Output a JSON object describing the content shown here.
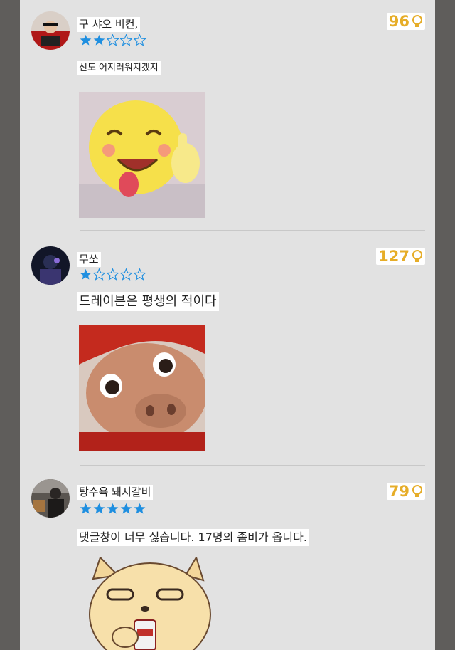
{
  "comments": [
    {
      "username": "구 샤오 비컨,",
      "rating": 2,
      "likes": "96",
      "text": "신도 어지러워지겠지",
      "sticker": "laughing-emoji-thumbs-up"
    },
    {
      "username": "무쏘",
      "rating": 1,
      "likes": "127",
      "text": "드레이븐은 평생의 적이다",
      "sticker": "cartoon-pig-face"
    },
    {
      "username": "탕수육 돼지갈비",
      "rating": 5,
      "likes": "79",
      "text": "댓글창이 너무 싫습니다. 17명의 좀비가 옵니다.",
      "sticker": "cat-drinking-bottle"
    }
  ],
  "colors": {
    "star_filled": "#1f8fe0",
    "star_empty": "#1f8fe0",
    "likes": "#e6ad28",
    "background": "#e2e2e2"
  },
  "icons": [
    "lightbulb-icon",
    "star-icon",
    "avatar"
  ]
}
